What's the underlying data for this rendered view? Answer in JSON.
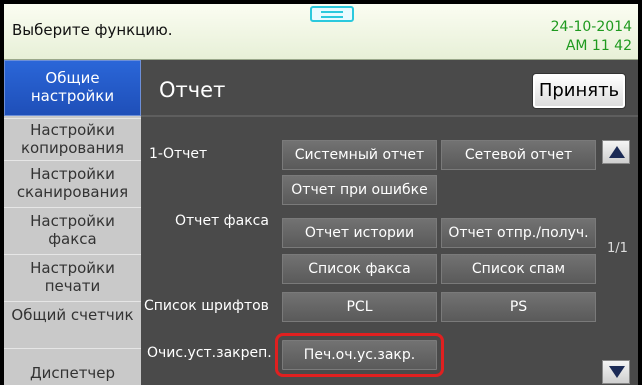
{
  "status_bar": {
    "message": "Выберите функцию.",
    "date": "24-10-2014",
    "time": "AM 11  42"
  },
  "sidebar": {
    "items": [
      {
        "label": "Общие настройки",
        "active": true
      },
      {
        "label": "Настройки копирования"
      },
      {
        "label": "Настройки сканирования"
      },
      {
        "label": "Настройки факса"
      },
      {
        "label": "Настройки печати"
      },
      {
        "label": "Общий счетчик"
      },
      {
        "label": "Диспетчер"
      }
    ]
  },
  "main": {
    "title": "Отчет",
    "accept_label": "Принять",
    "page_indicator": "1/1",
    "rows": {
      "report_label": "1-Отчет",
      "system_report": "Системный отчет",
      "network_report": "Сетевой отчет",
      "error_report": "Отчет при ошибке",
      "fax_report_label": "Отчет факса",
      "history_report": "Отчет истории",
      "send_receive_report": "Отчет отпр./получ.",
      "fax_list": "Список факса",
      "spam_list": "Список спам",
      "font_list_label": "Список шрифтов",
      "pcl": "PCL",
      "ps": "PS",
      "clear_hold_label": "Очис.уст.закреп.",
      "print_hold_queue": "Печ.оч.ус.закр."
    }
  },
  "colors": {
    "accent_blue": "#1f4fb8",
    "highlight_red": "#e02020",
    "time_green": "#1f9a1f",
    "handle_cyan": "#2bc9dd"
  },
  "icons": [
    "scroll-up-icon",
    "scroll-down-icon",
    "panel-handle-icon"
  ]
}
